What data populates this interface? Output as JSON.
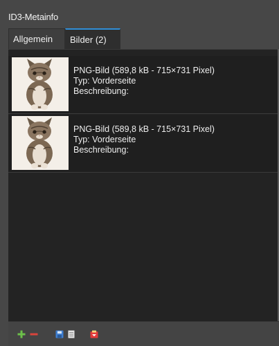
{
  "panel": {
    "title": "ID3-Metainfo"
  },
  "tabs": [
    {
      "label": "Allgemein",
      "active": false
    },
    {
      "label": "Bilder (2)",
      "active": true
    }
  ],
  "images": [
    {
      "info": "PNG-Bild (589,8 kB - 715×731 Pixel)",
      "type": "Typ: Vorderseite",
      "description": "Beschreibung:"
    },
    {
      "info": "PNG-Bild (589,8 kB - 715×731 Pixel)",
      "type": "Typ: Vorderseite",
      "description": "Beschreibung:"
    }
  ],
  "toolbar": {
    "buttons": [
      "add-icon",
      "remove-icon",
      "save-icon",
      "copy-icon",
      "paste-icon"
    ]
  },
  "colors": {
    "accent": "#2f8fd8",
    "add": "#6cc04a",
    "remove": "#d9443b"
  }
}
